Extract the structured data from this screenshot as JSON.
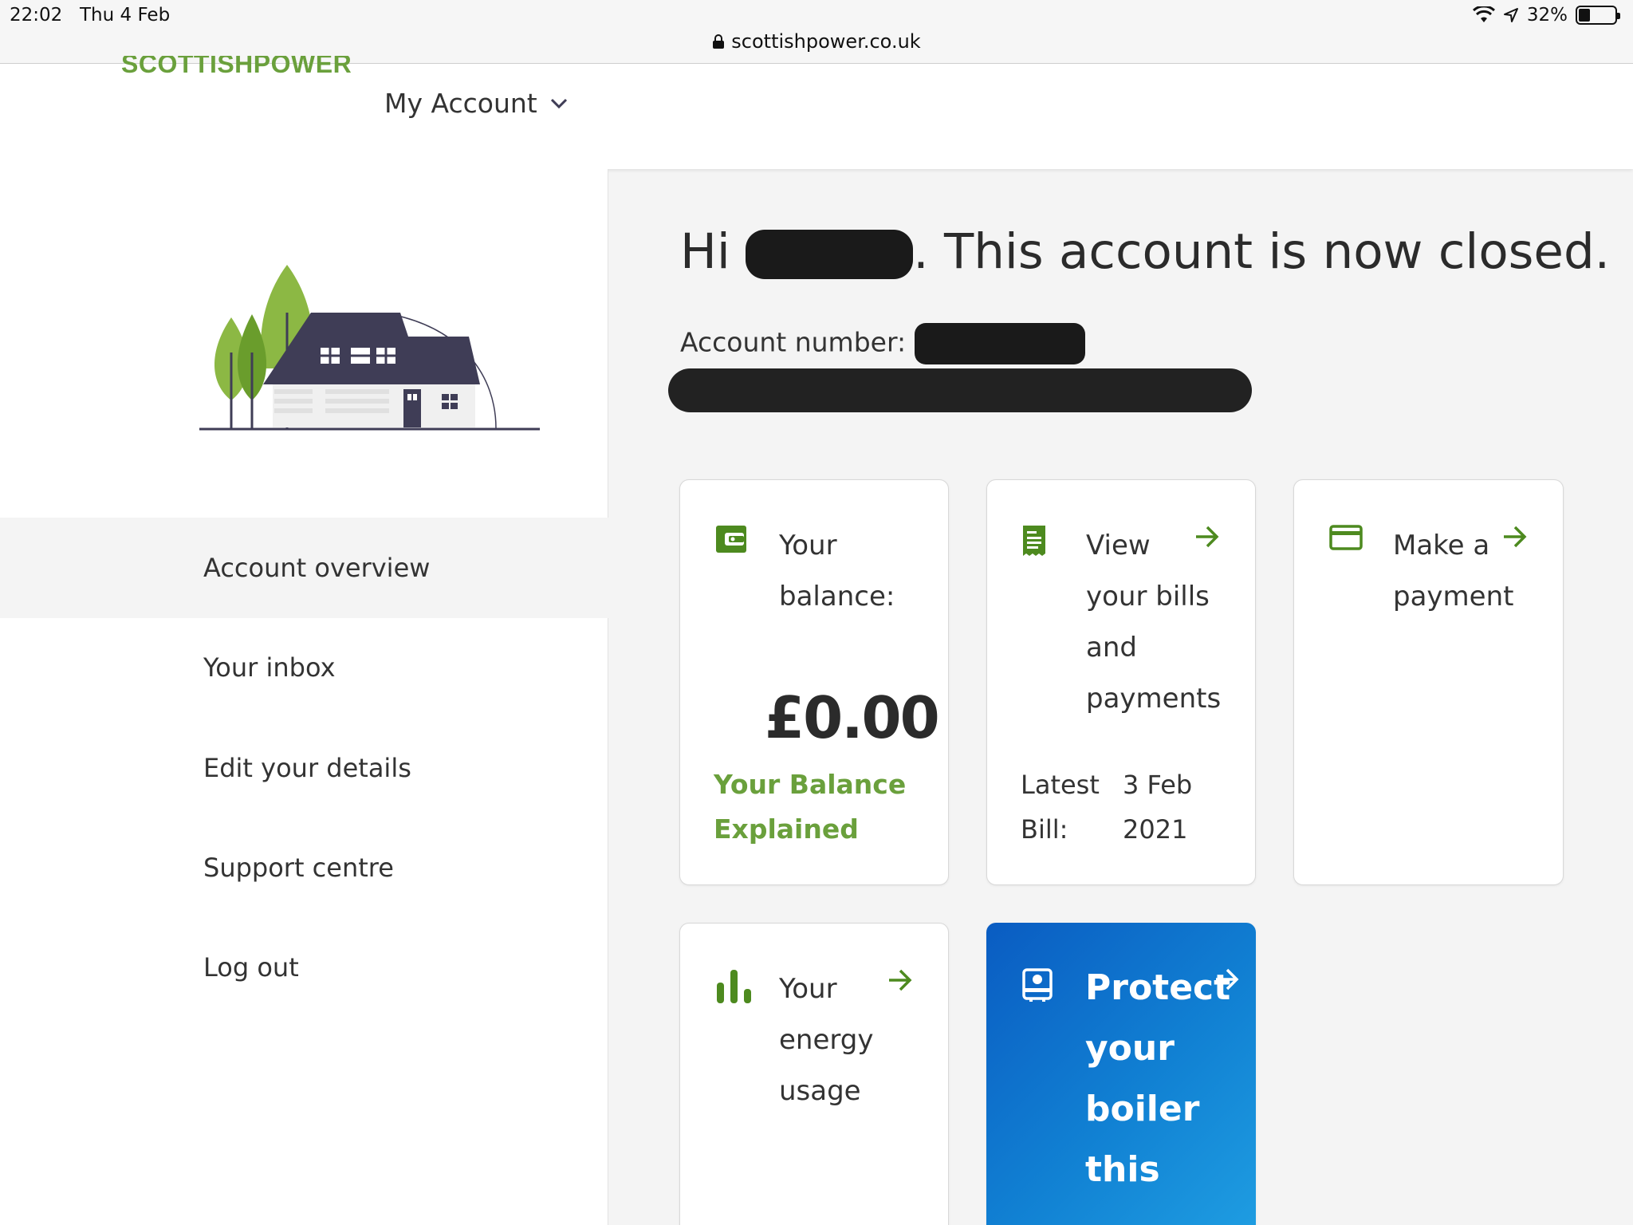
{
  "status_bar": {
    "time": "22:02",
    "date": "Thu 4 Feb",
    "battery": "32%",
    "url": "scottishpower.co.uk"
  },
  "header": {
    "logo_text": "SCOTTISHPOWER",
    "my_account_label": "My Account"
  },
  "sidebar": {
    "items": [
      {
        "label": "Account overview",
        "active": true
      },
      {
        "label": "Your inbox",
        "active": false
      },
      {
        "label": "Edit your details",
        "active": false
      },
      {
        "label": "Support centre",
        "active": false
      },
      {
        "label": "Log out",
        "active": false
      }
    ]
  },
  "main": {
    "greeting_prefix": "Hi",
    "greeting_suffix": ". This account is now closed.",
    "account_number_label": "Account number:",
    "cards": {
      "balance": {
        "title_line1": "Your",
        "title_line2": "balance:",
        "amount": "£0.00",
        "link_line1": "Your Balance",
        "link_line2": "Explained"
      },
      "bills": {
        "title_line1": "View",
        "title_line2": "your bills",
        "title_line3": "and",
        "title_line4": "payments",
        "latest_label_1": "Latest",
        "latest_label_2": "Bill:",
        "latest_date_1": "3 Feb",
        "latest_date_2": "2021"
      },
      "payment": {
        "title_line1": "Make a",
        "title_line2": "payment"
      },
      "usage": {
        "title_line1": "Your",
        "title_line2": "energy",
        "title_line3": "usage"
      },
      "boiler": {
        "title_line1": "Protect",
        "title_line2": "your",
        "title_line3": "boiler",
        "title_line4": "this"
      }
    }
  },
  "colors": {
    "brand_green": "#6aa03c",
    "arrow_green": "#4d8a1f",
    "boiler_blue": "#0a5cc2",
    "house_navy": "#3f3d56"
  }
}
